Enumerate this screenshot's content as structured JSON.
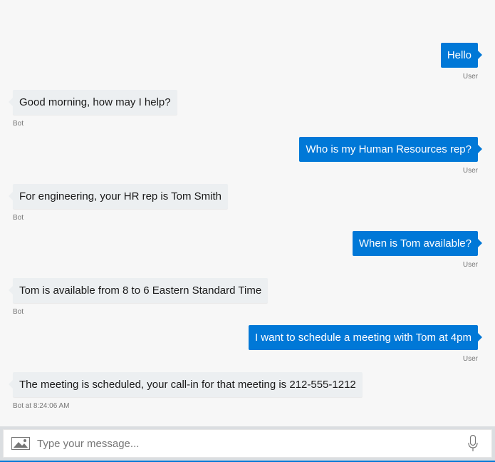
{
  "messages": [
    {
      "from": "user",
      "text": "Hello",
      "meta": "User"
    },
    {
      "from": "bot",
      "text": "Good morning, how may I help?",
      "meta": "Bot"
    },
    {
      "from": "user",
      "text": "Who is my Human Resources rep?",
      "meta": "User"
    },
    {
      "from": "bot",
      "text": "For engineering, your HR rep is Tom Smith",
      "meta": "Bot"
    },
    {
      "from": "user",
      "text": "When is Tom available?",
      "meta": "User"
    },
    {
      "from": "bot",
      "text": "Tom is available from 8 to 6 Eastern Standard Time",
      "meta": "Bot"
    },
    {
      "from": "user",
      "text": "I want to schedule a meeting with Tom at 4pm",
      "meta": "User"
    },
    {
      "from": "bot",
      "text": "The meeting is scheduled, your call-in for that meeting is 212-555-1212",
      "meta": "Bot at 8:24:06 AM"
    }
  ],
  "input": {
    "placeholder": "Type your message...",
    "value": ""
  },
  "icons": {
    "attach": "image-icon",
    "microphone": "microphone-icon"
  },
  "colors": {
    "user_bubble": "#0078d7",
    "bot_bubble": "#eceff1",
    "background": "#f7f7f7",
    "accent": "#0078d7"
  }
}
